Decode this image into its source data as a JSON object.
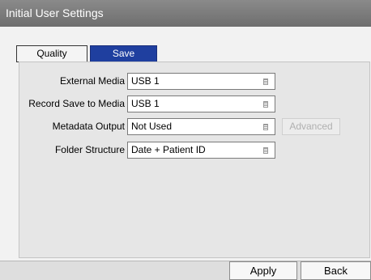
{
  "window": {
    "title": "Initial User Settings"
  },
  "tabs": [
    {
      "label": "Quality",
      "active": false
    },
    {
      "label": "Save",
      "active": true
    }
  ],
  "settings": [
    {
      "label": "External Media",
      "value": "USB 1"
    },
    {
      "label": "Record Save to Media",
      "value": "USB 1"
    },
    {
      "label": "Metadata Output",
      "value": "Not Used"
    },
    {
      "label": "Folder Structure",
      "value": "Date + Patient ID"
    }
  ],
  "advanced_button": {
    "label": "Advanced",
    "enabled": false
  },
  "footer": {
    "apply_label": "Apply",
    "back_label": "Back"
  },
  "colors": {
    "active_tab": "#1f3f9f",
    "titlebar": "#7a7a7a"
  }
}
